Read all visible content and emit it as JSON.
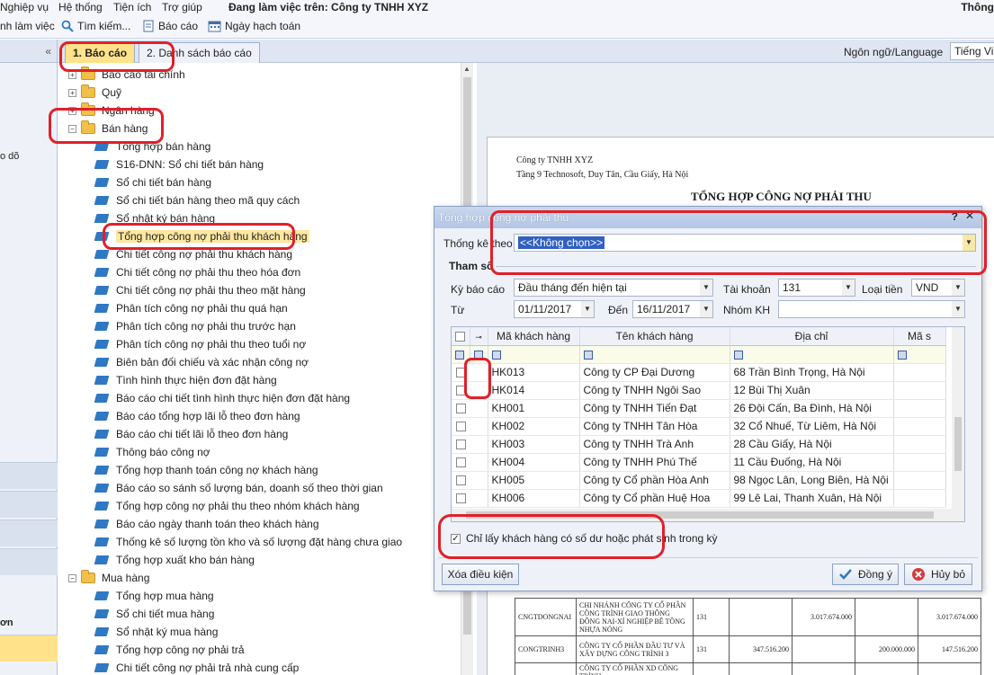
{
  "menu": {
    "items": [
      "Nghiệp vụ",
      "Hệ thống",
      "Tiện ích",
      "Trợ giúp"
    ],
    "working_on": "Đang làm việc trên: Công ty TNHH XYZ",
    "right_text": "Thông"
  },
  "toolbar": {
    "left_label": "nh làm việc",
    "search_label": "Tìm kiếm...",
    "report_label": "Báo cáo",
    "date_label": "Ngày hạch toán"
  },
  "leftnav": {
    "collapse_glyph": "«",
    "partial_text_1": "o dõ",
    "partial_text_2": "ơn"
  },
  "tabs": [
    {
      "label": "1. Báo cáo"
    },
    {
      "label": "2. Danh sách báo cáo"
    }
  ],
  "tree": {
    "items": [
      {
        "label": "Báo cáo tài chính",
        "type": "folder",
        "expander": "+"
      },
      {
        "label": "Quỹ",
        "type": "folder",
        "expander": "+"
      },
      {
        "label": "Ngân hàng",
        "type": "folder",
        "expander": "+"
      },
      {
        "label": "Bán hàng",
        "type": "folder",
        "expander": "−"
      },
      {
        "label": "Tổng hợp bán hàng",
        "type": "report"
      },
      {
        "label": "S16-DNN: Sổ chi tiết bán hàng",
        "type": "report"
      },
      {
        "label": "Sổ chi tiết bán hàng",
        "type": "report"
      },
      {
        "label": "Sổ chi tiết bán hàng theo mã quy cách",
        "type": "report"
      },
      {
        "label": "Sổ nhật ký bán hàng",
        "type": "report"
      },
      {
        "label": "Tổng hợp công nợ phải thu khách hàng",
        "type": "report",
        "selected": true
      },
      {
        "label": "Chi tiết công nợ phải thu khách hàng",
        "type": "report"
      },
      {
        "label": "Chi tiết công nợ phải thu theo hóa đơn",
        "type": "report"
      },
      {
        "label": "Chi tiết công nợ phải thu theo mặt hàng",
        "type": "report"
      },
      {
        "label": "Phân tích công nợ phải thu quá hạn",
        "type": "report"
      },
      {
        "label": "Phân tích công nợ phải thu trước hạn",
        "type": "report"
      },
      {
        "label": "Phân tích công nợ phải thu theo tuổi nợ",
        "type": "report"
      },
      {
        "label": "Biên bản đối chiếu và xác nhận công nợ",
        "type": "report"
      },
      {
        "label": "Tình hình thực hiện đơn đặt hàng",
        "type": "report"
      },
      {
        "label": "Báo cáo chi tiết tình hình thực hiện đơn đặt hàng",
        "type": "report"
      },
      {
        "label": "Báo cáo tổng hợp lãi lỗ theo đơn hàng",
        "type": "report"
      },
      {
        "label": "Báo cáo chi tiết lãi lỗ theo đơn hàng",
        "type": "report"
      },
      {
        "label": "Thông báo công nợ",
        "type": "report"
      },
      {
        "label": "Tổng hợp thanh toán công nợ khách hàng",
        "type": "report"
      },
      {
        "label": "Báo cáo so sánh số lượng bán, doanh số theo thời gian",
        "type": "report"
      },
      {
        "label": "Tổng hợp công nợ phải thu theo nhóm khách hàng",
        "type": "report"
      },
      {
        "label": "Báo cáo ngày thanh toán theo khách hàng",
        "type": "report"
      },
      {
        "label": "Thống kê số lượng tồn kho và số lượng đặt hàng chưa giao",
        "type": "report"
      },
      {
        "label": "Tổng hợp xuất kho bán hàng",
        "type": "report"
      },
      {
        "label": "Mua hàng",
        "type": "folder",
        "expander": "−"
      },
      {
        "label": "Tổng hợp mua hàng",
        "type": "report"
      },
      {
        "label": "Sổ chi tiết mua hàng",
        "type": "report"
      },
      {
        "label": "Sổ nhật ký mua hàng",
        "type": "report"
      },
      {
        "label": "Tổng hợp công nợ phải trả",
        "type": "report"
      },
      {
        "label": "Chi tiết công nợ phải trả nhà cung cấp",
        "type": "report"
      }
    ]
  },
  "language": {
    "label": "Ngôn ngữ/Language",
    "value": "Tiếng Việt"
  },
  "document": {
    "company": "Công ty TNHH XYZ",
    "address": "Tầng 9 Technosoft, Duy Tân, Cầu Giấy, Hà Nội",
    "title": "TỔNG HỢP CÔNG NỢ PHẢI THU",
    "rows": [
      {
        "code": "CNGTDONGNAI",
        "name": "CHI NHÁNH CÔNG TY CỔ PHẦN CÔNG TRÌNH GIAO THÔNG ĐỒNG NAI-XÍ NGHIỆP BÊ TÔNG NHỰA NÓNG",
        "account": "131",
        "v1": "",
        "v2": "3.017.674.000",
        "v3": "",
        "v4": "3.017.674.000"
      },
      {
        "code": "CONGTRINH3",
        "name": "CÔNG TY CỔ PHẦN ĐẦU TƯ VÀ XÂY DỰNG CÔNG TRÌNH 3",
        "account": "131",
        "v1": "347.516.200",
        "v2": "",
        "v3": "200.000.000",
        "v4": "147.516.200"
      },
      {
        "code": "",
        "name": "CÔNG TY CỔ PHẦN XD CÔNG TRÌNH",
        "account": "",
        "v1": "",
        "v2": "",
        "v3": "",
        "v4": ""
      }
    ]
  },
  "dialog": {
    "title": "Tổng hợp công nợ phải thu",
    "help": "?",
    "close": "✕",
    "stat_by_label": "Thống kê theo",
    "stat_by_value": "<<Không chọn>>",
    "params_label": "Tham số",
    "period_label": "Kỳ báo cáo",
    "period_value": "Đầu tháng đến hiện tại",
    "account_label": "Tài khoản",
    "account_value": "131",
    "currency_label": "Loại tiền",
    "currency_value": "VND",
    "from_label": "Từ",
    "from_value": "01/11/2017",
    "to_label": "Đến",
    "to_value": "16/11/2017",
    "group_label": "Nhóm KH",
    "group_value": "",
    "grid": {
      "columns": [
        "Mã khách hàng",
        "Tên khách hàng",
        "Địa chỉ",
        "Mã s"
      ],
      "rows": [
        {
          "code": "HK013",
          "name": "Công ty CP Đại Dương",
          "address": "68 Trần Bình Trọng, Hà Nội"
        },
        {
          "code": "HK014",
          "name": "Công ty TNHH Ngôi Sao",
          "address": "12 Bùi Thị Xuân"
        },
        {
          "code": "KH001",
          "name": "Công ty TNHH Tiến Đạt",
          "address": "26 Đội Cấn, Ba Đình, Hà Nội"
        },
        {
          "code": "KH002",
          "name": "Công ty TNHH Tân Hòa",
          "address": "32 Cổ Nhuế, Từ Liêm, Hà Nội"
        },
        {
          "code": "KH003",
          "name": "Công ty TNHH Trà Anh",
          "address": "28 Cầu Giấy, Hà Nội"
        },
        {
          "code": "KH004",
          "name": "Công ty TNHH Phú Thế",
          "address": "11 Cầu Đuống, Hà Nội"
        },
        {
          "code": "KH005",
          "name": "Công ty Cổ phần Hòa Anh",
          "address": "98 Ngọc Lân, Long Biên, Hà Nội"
        },
        {
          "code": "KH006",
          "name": "Công ty Cổ phần Huệ Hoa",
          "address": "99 Lê Lai, Thanh Xuân, Hà Nội"
        }
      ]
    },
    "only_with_balance_label": "Chỉ lấy khách hàng có số dư hoặc phát sinh trong kỳ",
    "clear_conditions": "Xóa điều kiện",
    "ok": "Đồng ý",
    "cancel": "Hủy bỏ"
  },
  "colors": {
    "annotation": "#e0202a",
    "active_tab": "#ffe28a",
    "selection": "#ffe7a0"
  }
}
